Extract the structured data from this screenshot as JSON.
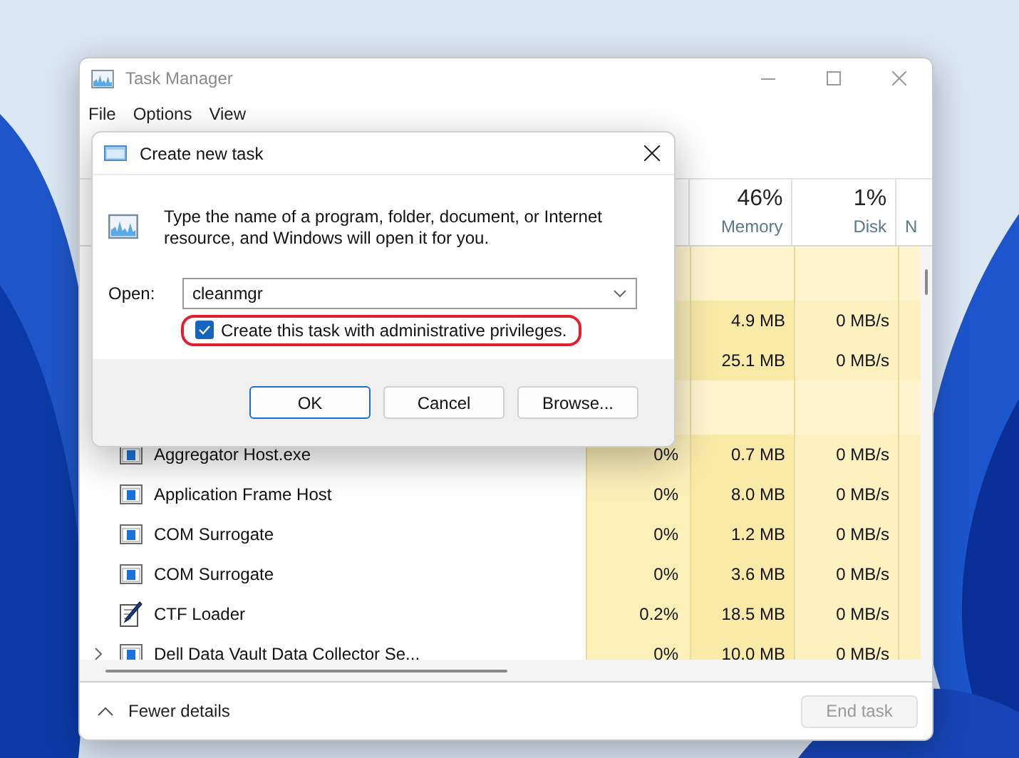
{
  "window": {
    "title": "Task Manager",
    "menu": [
      "File",
      "Options",
      "View"
    ]
  },
  "columns": [
    {
      "percent": "46%",
      "label": "Memory"
    },
    {
      "percent": "1%",
      "label": "Disk"
    },
    {
      "label": "N"
    }
  ],
  "rows": [
    {
      "kind": "group"
    },
    {
      "kind": "process",
      "memory": "4.9 MB",
      "disk": "0 MB/s"
    },
    {
      "kind": "process",
      "memory": "25.1 MB",
      "disk": "0 MB/s"
    },
    {
      "kind": "group"
    },
    {
      "kind": "process",
      "name": "Aggregator Host.exe",
      "cpu": "0%",
      "memory": "0.7 MB",
      "disk": "0 MB/s"
    },
    {
      "kind": "process",
      "name": "Application Frame Host",
      "cpu": "0%",
      "memory": "8.0 MB",
      "disk": "0 MB/s"
    },
    {
      "kind": "process",
      "name": "COM Surrogate",
      "cpu": "0%",
      "memory": "1.2 MB",
      "disk": "0 MB/s"
    },
    {
      "kind": "process",
      "name": "COM Surrogate",
      "cpu": "0%",
      "memory": "3.6 MB",
      "disk": "0 MB/s"
    },
    {
      "kind": "tool",
      "name": "CTF Loader",
      "cpu": "0.2%",
      "memory": "18.5 MB",
      "disk": "0 MB/s"
    },
    {
      "kind": "process",
      "name": "Dell Data Vault Data Collector Se...",
      "cpu": "0%",
      "memory": "10.0 MB",
      "disk": "0 MB/s",
      "expanded": false
    }
  ],
  "footer": {
    "toggle": "Fewer details",
    "end_task": {
      "label": "End task",
      "disabled": true
    }
  },
  "dialog": {
    "title": "Create new task",
    "message": "Type the name of a program, folder, document, or Internet resource, and Windows will open it for you.",
    "open_label": "Open:",
    "open_value": "cleanmgr",
    "admin": {
      "label": "Create this task with administrative privileges.",
      "checked": true,
      "highlighted": true
    },
    "buttons": [
      {
        "label": "OK",
        "default": true
      },
      {
        "label": "Cancel",
        "default": false
      },
      {
        "label": "Browse...",
        "default": false
      }
    ]
  }
}
